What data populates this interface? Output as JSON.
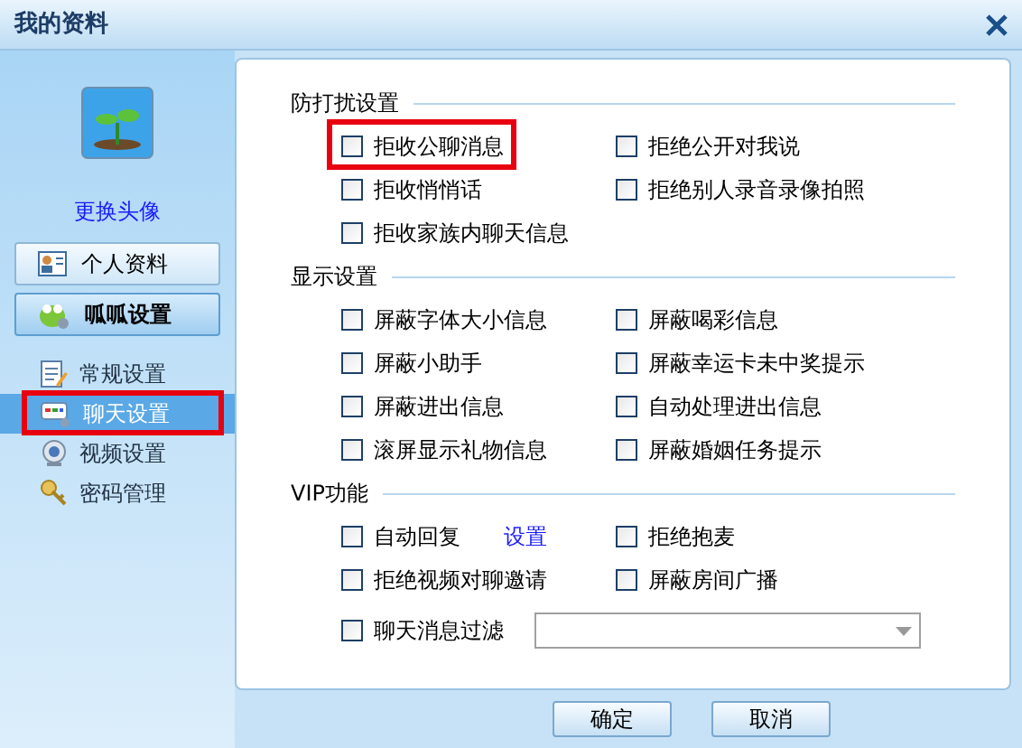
{
  "window": {
    "title": "我的资料"
  },
  "sidebar": {
    "change_avatar": "更换头像",
    "buttons": [
      {
        "label": "个人资料",
        "selected": false
      },
      {
        "label": "呱呱设置",
        "selected": true
      }
    ],
    "items": [
      {
        "label": "常规设置",
        "selected": false,
        "highlighted": false
      },
      {
        "label": "聊天设置",
        "selected": true,
        "highlighted": true
      },
      {
        "label": "视频设置",
        "selected": false,
        "highlighted": false
      },
      {
        "label": "密码管理",
        "selected": false,
        "highlighted": false
      }
    ]
  },
  "sections": [
    {
      "title": "防打扰设置",
      "rows": [
        [
          {
            "kind": "checkbox",
            "label": "拒收公聊消息",
            "checked": false,
            "highlighted": true
          },
          {
            "kind": "checkbox",
            "label": "拒绝公开对我说",
            "checked": false
          }
        ],
        [
          {
            "kind": "checkbox",
            "label": "拒收悄悄话",
            "checked": false
          },
          {
            "kind": "checkbox",
            "label": "拒绝别人录音录像拍照",
            "checked": false
          }
        ],
        [
          {
            "kind": "checkbox",
            "label": "拒收家族内聊天信息",
            "checked": false
          }
        ]
      ]
    },
    {
      "title": "显示设置",
      "rows": [
        [
          {
            "kind": "checkbox",
            "label": "屏蔽字体大小信息",
            "checked": false
          },
          {
            "kind": "checkbox",
            "label": "屏蔽喝彩信息",
            "checked": false
          }
        ],
        [
          {
            "kind": "checkbox",
            "label": "屏蔽小助手",
            "checked": false
          },
          {
            "kind": "checkbox",
            "label": "屏蔽幸运卡未中奖提示",
            "checked": false
          }
        ],
        [
          {
            "kind": "checkbox",
            "label": "屏蔽进出信息",
            "checked": false
          },
          {
            "kind": "checkbox",
            "label": "自动处理进出信息",
            "checked": false
          }
        ],
        [
          {
            "kind": "checkbox",
            "label": "滚屏显示礼物信息",
            "checked": false
          },
          {
            "kind": "checkbox",
            "label": "屏蔽婚姻任务提示",
            "checked": false
          }
        ]
      ]
    },
    {
      "title": "VIP功能",
      "rows": [
        [
          {
            "kind": "checkbox",
            "label": "自动回复",
            "checked": false,
            "link": "设置"
          },
          {
            "kind": "checkbox",
            "label": "拒绝抱麦",
            "checked": false
          }
        ],
        [
          {
            "kind": "checkbox",
            "label": "拒绝视频对聊邀请",
            "checked": false
          },
          {
            "kind": "checkbox",
            "label": "屏蔽房间广播",
            "checked": false
          }
        ],
        [
          {
            "kind": "checkbox",
            "label": "聊天消息过滤",
            "checked": false
          },
          {
            "kind": "dropdown"
          }
        ]
      ]
    }
  ],
  "buttons": [
    "确定",
    "取消"
  ]
}
